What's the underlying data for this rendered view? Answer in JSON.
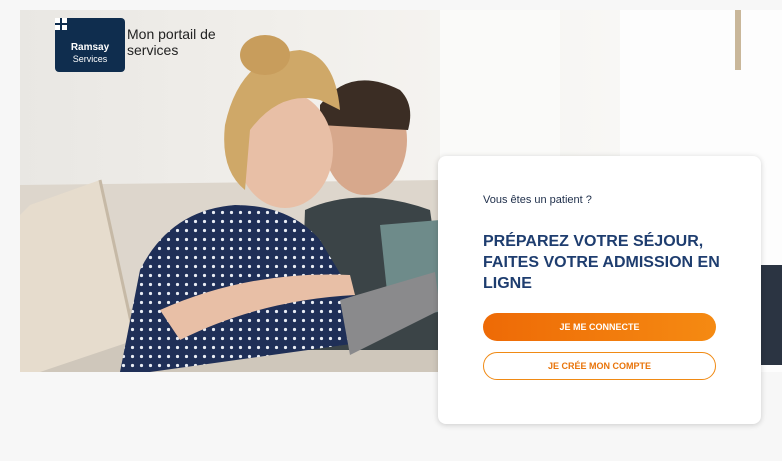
{
  "brand": {
    "logo_name": "Ramsay",
    "logo_sub": "Services",
    "portal_title": "Mon portail de services"
  },
  "card": {
    "kicker": "Vous êtes un patient ?",
    "heading": "PRÉPAREZ VOTRE SÉJOUR, FAITES VOTRE ADMISSION EN LIGNE",
    "login_button": "JE ME CONNECTE",
    "signup_button": "JE CRÉE MON COMPTE"
  },
  "colors": {
    "brand_navy": "#0f2d4e",
    "heading_blue": "#1e3d6f",
    "accent_orange": "#f07d0c"
  },
  "icons": {
    "logo_mark": "ramsay-cross-icon"
  }
}
